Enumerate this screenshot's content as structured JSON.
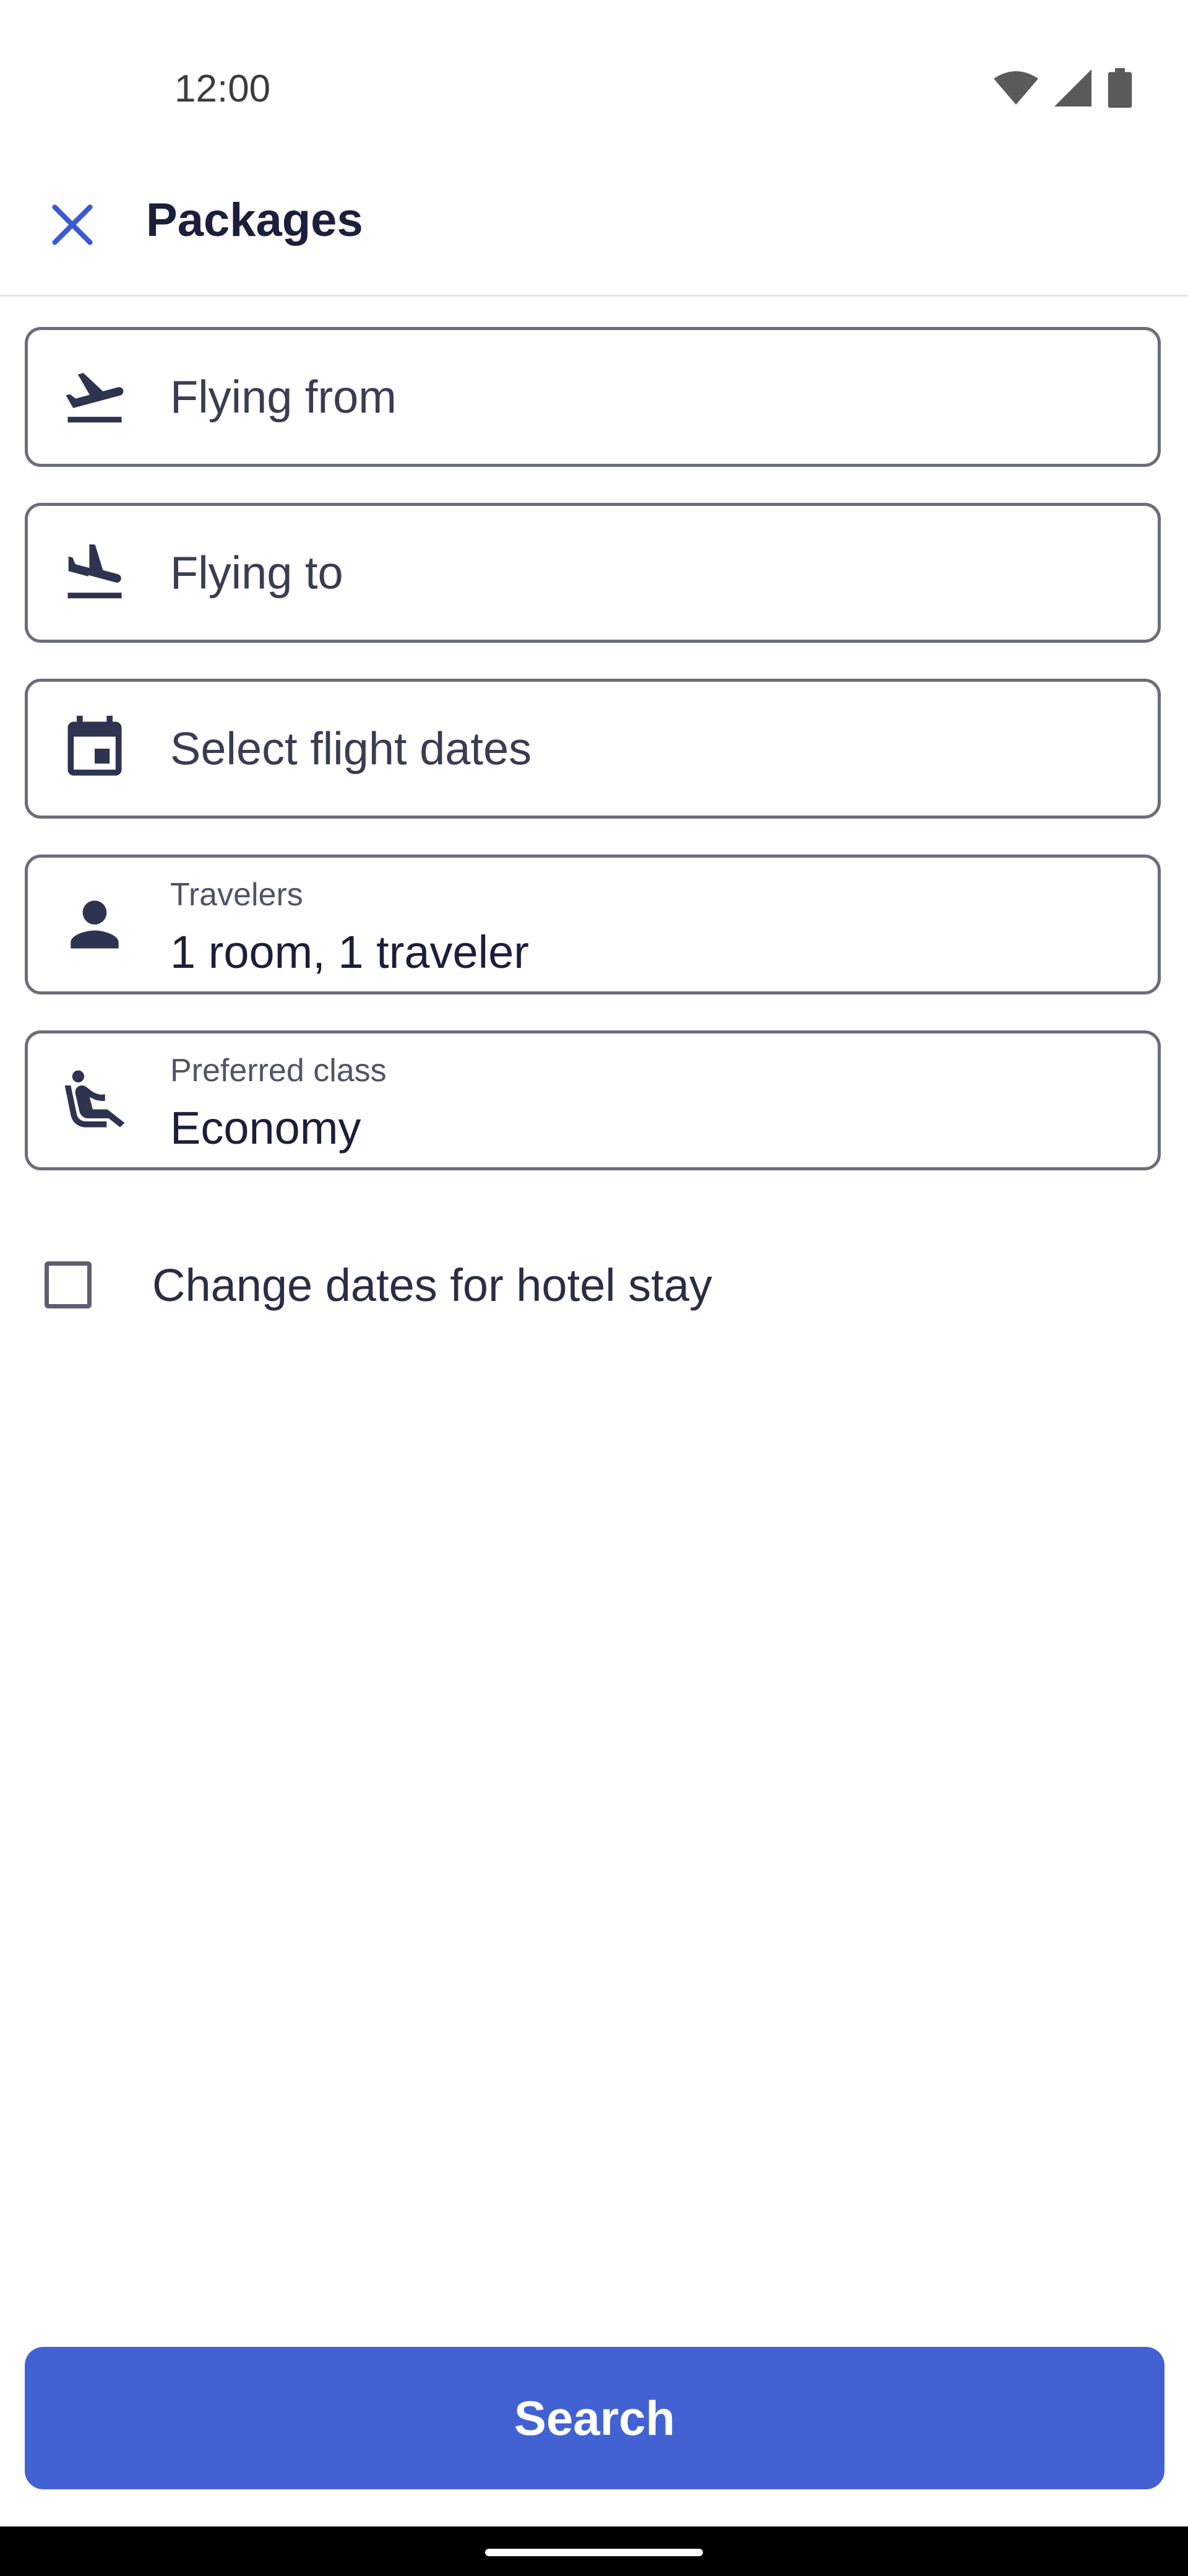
{
  "status_bar": {
    "time": "12:00",
    "icons": [
      "wifi-icon",
      "cellular-signal-icon",
      "battery-icon"
    ]
  },
  "app_bar": {
    "title": "Packages",
    "close_icon": "close-icon"
  },
  "form": {
    "flying_from": {
      "placeholder": "Flying from",
      "icon": "airplane-takeoff-icon"
    },
    "flying_to": {
      "placeholder": "Flying to",
      "icon": "airplane-landing-icon"
    },
    "dates": {
      "placeholder": "Select flight dates",
      "icon": "calendar-icon"
    },
    "travelers": {
      "label": "Travelers",
      "value": "1 room, 1 traveler",
      "icon": "person-icon"
    },
    "preferred_class": {
      "label": "Preferred class",
      "value": "Economy",
      "icon": "seat-icon"
    },
    "hotel_dates_checkbox": {
      "label": "Change dates for hotel stay",
      "checked": false
    }
  },
  "search_button": {
    "label": "Search"
  },
  "colors": {
    "accent": "#4262d4",
    "close_icon": "#3a5bd0",
    "text_dark": "#1c1f3b",
    "field_border": "#6b6d7c"
  }
}
